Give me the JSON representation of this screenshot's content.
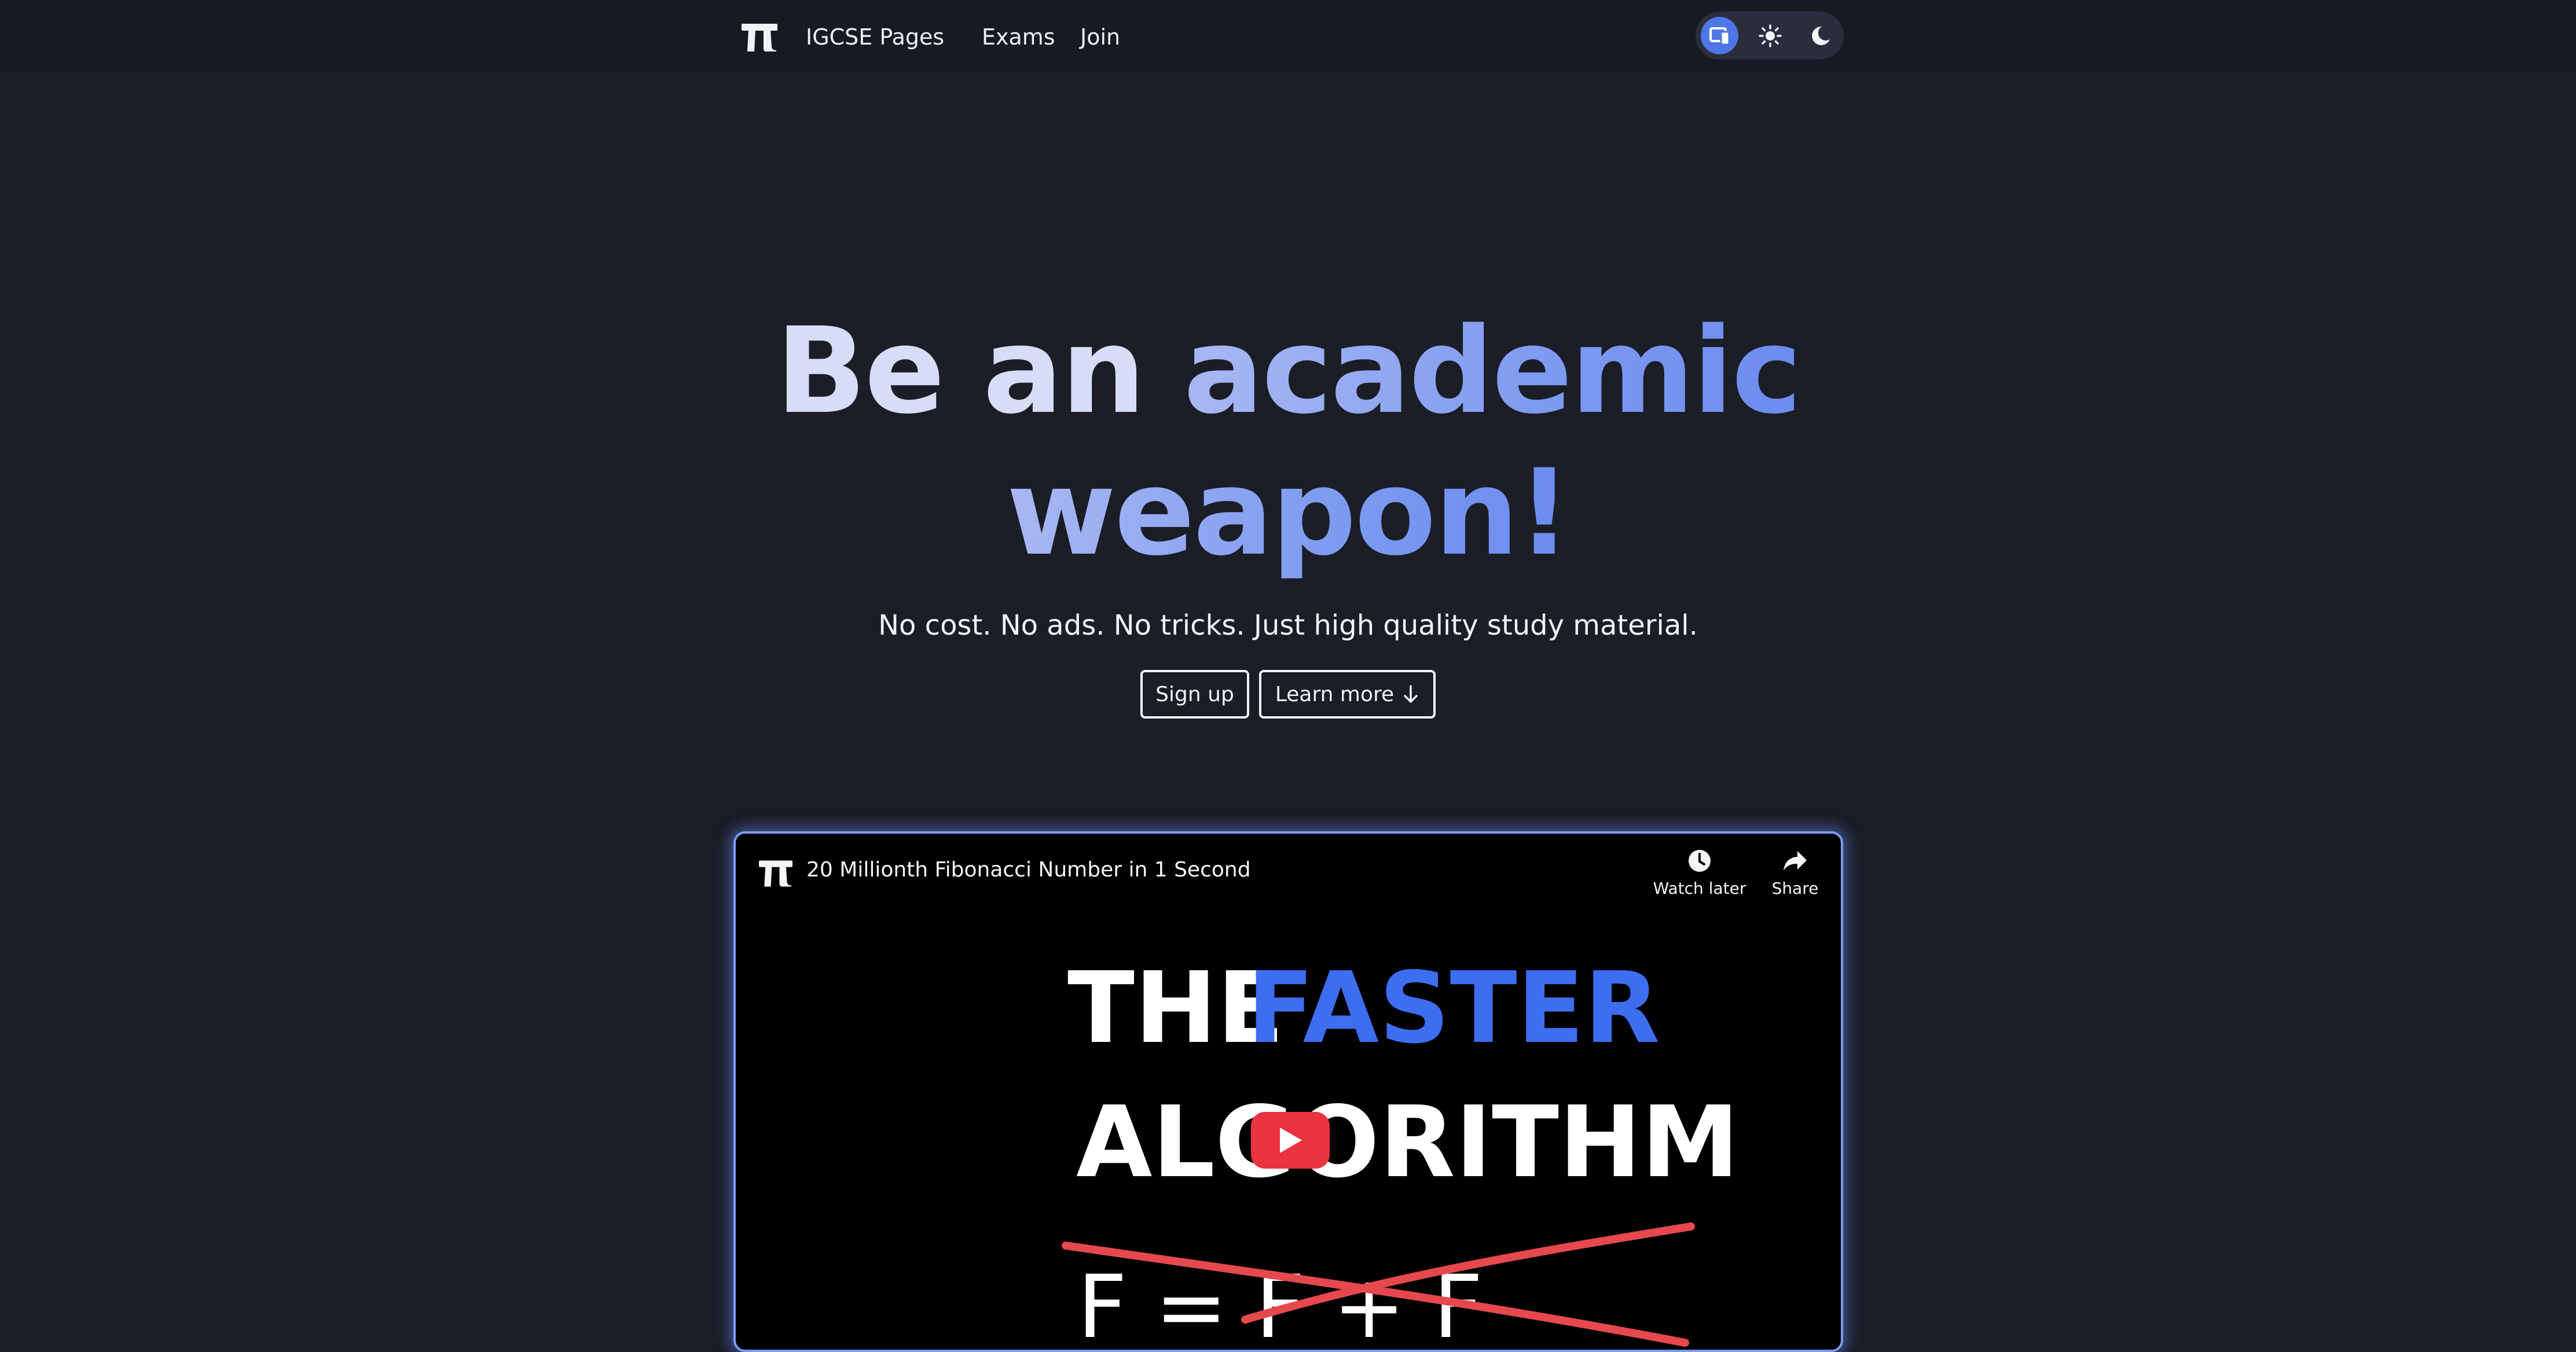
{
  "nav": {
    "brand": "IGCSE Pages",
    "links": [
      "Exams",
      "Join"
    ],
    "theme_options": [
      "system",
      "light",
      "dark"
    ],
    "active_theme": "system"
  },
  "hero": {
    "title_lead": "Be an ",
    "title_accent_1": "academic",
    "title_accent_2": "weapon!",
    "subtitle": "No cost. No ads. No tricks. Just high quality study material.",
    "signup_label": "Sign up",
    "learn_more_label": "Learn more"
  },
  "video": {
    "title": "20 Millionth Fibonacci Number in 1 Second",
    "watch_later_label": "Watch later",
    "share_label": "Share",
    "thumbnail": {
      "line1_white": "THE",
      "line1_blue": "FASTER",
      "line2": "ALGORITHM",
      "formula": "F = F + F"
    }
  },
  "colors": {
    "background": "#1b1d27",
    "navbar": "#181a23",
    "accent": "#7c9af0",
    "active_theme_bg": "#4e76e6",
    "play_button": "#ea3340",
    "thumb_blue": "#3d6ef0",
    "strike_red": "#e5484d"
  },
  "icons": {
    "logo": "pi-logo-icon",
    "system_theme": "device-icon",
    "light_theme": "sun-icon",
    "dark_theme": "moon-icon",
    "learn_more": "arrow-down-icon",
    "watch_later": "clock-icon",
    "share": "share-icon",
    "play": "play-icon"
  }
}
